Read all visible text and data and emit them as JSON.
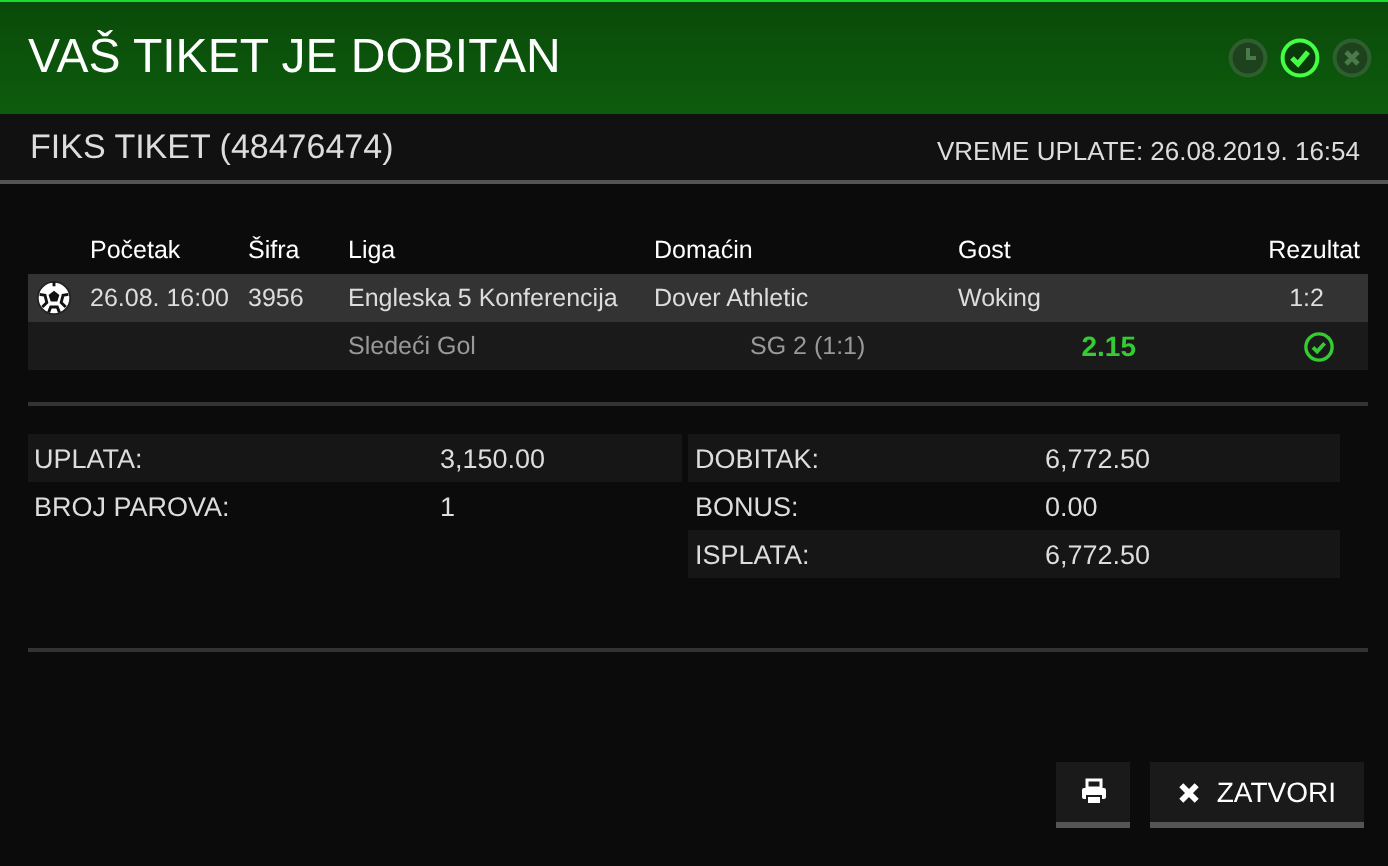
{
  "header": {
    "title": "VAŠ TIKET JE DOBITAN",
    "status_icons": [
      {
        "kind": "clock",
        "selected": false
      },
      {
        "kind": "check",
        "selected": true
      },
      {
        "kind": "close",
        "selected": false
      }
    ]
  },
  "ticket": {
    "title": "FIKS TIKET (48476474)",
    "paid_time": "VREME UPLATE: 26.08.2019. 16:54"
  },
  "table": {
    "columns": [
      "Početak",
      "Šifra",
      "Liga",
      "Domaćin",
      "Gost",
      "Rezultat"
    ],
    "rows": [
      {
        "start": "26.08. 16:00",
        "code": "3956",
        "league": "Engleska 5 Konferencija",
        "home": "Dover Athletic",
        "away": "Woking",
        "result": "1:2",
        "bet_type": "Sledeći Gol",
        "pick": "SG 2 (1:1)",
        "odds": "2.15",
        "won": true
      }
    ]
  },
  "summary": {
    "left": [
      {
        "label": "UPLATA:",
        "value": "3,150.00"
      },
      {
        "label": "BROJ PAROVA:",
        "value": "1"
      }
    ],
    "right": [
      {
        "label": "DOBITAK:",
        "value": "6,772.50"
      },
      {
        "label": "BONUS:",
        "value": "0.00"
      },
      {
        "label": "ISPLATA:",
        "value": "6,772.50"
      }
    ]
  },
  "buttons": [
    {
      "kind": "print"
    },
    {
      "kind": "close",
      "label": "ZATVORI"
    }
  ]
}
